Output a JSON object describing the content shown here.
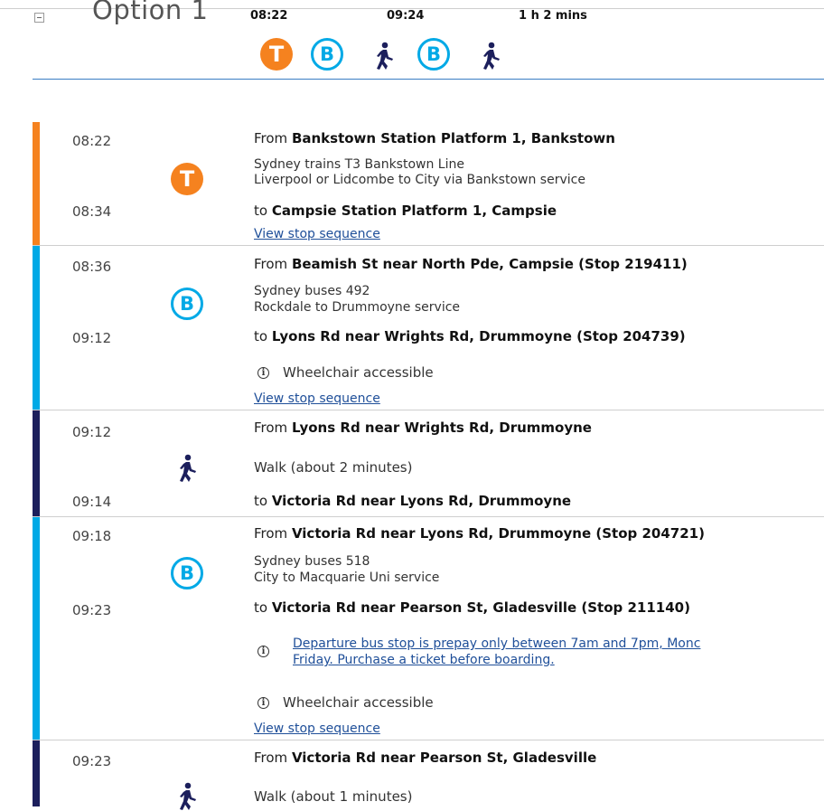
{
  "header": {
    "title": "Option 1",
    "depart": "08:22",
    "arrive": "09:24",
    "duration": "1 h 2 mins",
    "modes": [
      "train-icon",
      "bus-icon",
      "walk-icon",
      "bus-icon",
      "walk-icon"
    ]
  },
  "icons": {
    "train": "T",
    "bus": "B",
    "info": "i"
  },
  "colors": {
    "train": "#f5821f",
    "bus": "#00a9e6",
    "walk": "#1c1f5c",
    "link": "#1f4f99"
  },
  "legs": [
    {
      "mode": "train",
      "from_time": "08:22",
      "to_time": "08:34",
      "from_prefix": "From ",
      "from_stop": "Bankstown Station Platform 1, Bankstown",
      "service_line1": "Sydney trains T3 Bankstown Line",
      "service_line2": "Liverpool or Lidcombe to City via Bankstown service",
      "to_prefix": "to ",
      "to_stop": "Campsie Station Platform 1, Campsie",
      "link": "View stop sequence"
    },
    {
      "mode": "bus",
      "from_time": "08:36",
      "to_time": "09:12",
      "from_prefix": "From ",
      "from_stop": "Beamish St near North Pde, Campsie (Stop 219411)",
      "service_line1": "Sydney buses 492",
      "service_line2": "Rockdale to Drummoyne service",
      "to_prefix": "to ",
      "to_stop": "Lyons Rd near Wrights Rd, Drummoyne (Stop 204739)",
      "note": "Wheelchair accessible",
      "link": "View stop sequence"
    },
    {
      "mode": "walk",
      "from_time": "09:12",
      "to_time": "09:14",
      "from_prefix": "From ",
      "from_stop": "Lyons Rd near Wrights Rd, Drummoyne",
      "walk_text": "Walk (about 2 minutes)",
      "to_prefix": "to ",
      "to_stop": "Victoria Rd near Lyons Rd, Drummoyne"
    },
    {
      "mode": "bus",
      "from_time": "09:18",
      "to_time": "09:23",
      "from_prefix": "From ",
      "from_stop": "Victoria Rd near Lyons Rd, Drummoyne (Stop 204721)",
      "service_line1": "Sydney buses 518",
      "service_line2": "City to Macquarie Uni service",
      "to_prefix": "to ",
      "to_stop": "Victoria Rd near Pearson St, Gladesville (Stop 211140)",
      "alert_line1": "Departure bus stop is prepay only between 7am and 7pm, Monc",
      "alert_line2": "Friday. Purchase a ticket before boarding.",
      "note": "Wheelchair accessible",
      "link": "View stop sequence"
    },
    {
      "mode": "walk",
      "from_time": "09:23",
      "from_prefix": "From ",
      "from_stop": "Victoria Rd near Pearson St, Gladesville",
      "walk_text": "Walk (about 1 minutes)"
    }
  ]
}
